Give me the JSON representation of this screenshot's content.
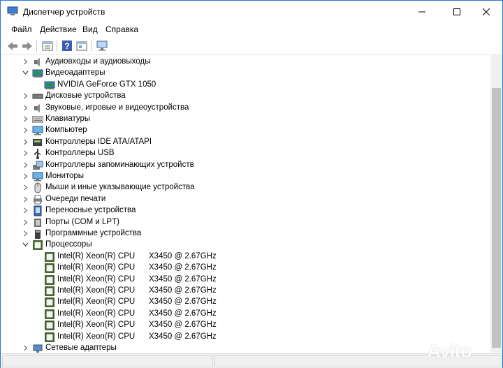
{
  "window": {
    "title": "Диспетчер устройств"
  },
  "menu": [
    "Файл",
    "Действие",
    "Вид",
    "Справка"
  ],
  "toolbar_icons": [
    "back-arrow-icon",
    "forward-arrow-icon",
    "properties-icon",
    "help-icon",
    "view-icon",
    "monitor-scan-icon"
  ],
  "tree": {
    "categories": [
      {
        "label": "Аудиовходы и аудиовыходы",
        "expanded": false,
        "icon": "speaker-icon"
      },
      {
        "label": "Видеоадаптеры",
        "expanded": true,
        "icon": "display-adapter-icon",
        "children": [
          {
            "label": "NVIDIA GeForce GTX 1050",
            "icon": "display-adapter-icon"
          }
        ]
      },
      {
        "label": "Дисковые устройства",
        "expanded": false,
        "icon": "disk-icon"
      },
      {
        "label": "Звуковые, игровые и видеоустройства",
        "expanded": false,
        "icon": "speaker-icon"
      },
      {
        "label": "Клавиатуры",
        "expanded": false,
        "icon": "keyboard-icon"
      },
      {
        "label": "Компьютер",
        "expanded": false,
        "icon": "monitor-icon"
      },
      {
        "label": "Контроллеры IDE ATA/ATAPI",
        "expanded": false,
        "icon": "ide-controller-icon"
      },
      {
        "label": "Контроллеры USB",
        "expanded": false,
        "icon": "usb-icon"
      },
      {
        "label": "Контроллеры запоминающих устройств",
        "expanded": false,
        "icon": "storage-controller-icon"
      },
      {
        "label": "Мониторы",
        "expanded": false,
        "icon": "monitor-icon"
      },
      {
        "label": "Мыши и иные указывающие устройства",
        "expanded": false,
        "icon": "mouse-icon"
      },
      {
        "label": "Очереди печати",
        "expanded": false,
        "icon": "printer-icon"
      },
      {
        "label": "Переносные устройства",
        "expanded": false,
        "icon": "portable-device-icon"
      },
      {
        "label": "Порты (COM и LPT)",
        "expanded": false,
        "icon": "port-icon"
      },
      {
        "label": "Программные устройства",
        "expanded": false,
        "icon": "software-device-icon"
      },
      {
        "label": "Процессоры",
        "expanded": true,
        "icon": "cpu-icon",
        "children": [
          {
            "label": "Intel(R) Xeon(R) CPU",
            "model": "X3450  @ 2.67GHz",
            "icon": "cpu-icon"
          },
          {
            "label": "Intel(R) Xeon(R) CPU",
            "model": "X3450  @ 2.67GHz",
            "icon": "cpu-icon"
          },
          {
            "label": "Intel(R) Xeon(R) CPU",
            "model": "X3450  @ 2.67GHz",
            "icon": "cpu-icon"
          },
          {
            "label": "Intel(R) Xeon(R) CPU",
            "model": "X3450  @ 2.67GHz",
            "icon": "cpu-icon"
          },
          {
            "label": "Intel(R) Xeon(R) CPU",
            "model": "X3450  @ 2.67GHz",
            "icon": "cpu-icon"
          },
          {
            "label": "Intel(R) Xeon(R) CPU",
            "model": "X3450  @ 2.67GHz",
            "icon": "cpu-icon"
          },
          {
            "label": "Intel(R) Xeon(R) CPU",
            "model": "X3450  @ 2.67GHz",
            "icon": "cpu-icon"
          },
          {
            "label": "Intel(R) Xeon(R) CPU",
            "model": "X3450  @ 2.67GHz",
            "icon": "cpu-icon"
          }
        ]
      },
      {
        "label": "Сетевые адаптеры",
        "expanded": false,
        "icon": "network-adapter-icon"
      }
    ]
  },
  "watermark": "Avito"
}
